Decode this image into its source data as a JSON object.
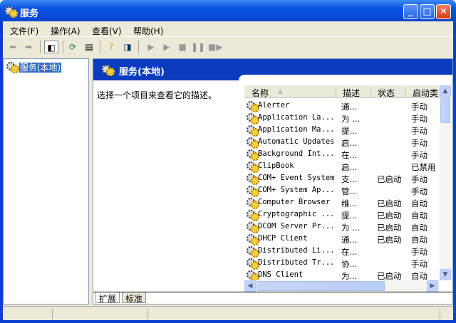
{
  "window": {
    "title": "服务"
  },
  "menu": [
    "文件(F)",
    "操作(A)",
    "查看(V)",
    "帮助(H)"
  ],
  "tree": {
    "node": "服务(本地)"
  },
  "header": {
    "title": "服务(本地)"
  },
  "description": "选择一个项目来查看它的描述。",
  "columns": [
    "名称",
    "描述",
    "状态",
    "启动类"
  ],
  "rows": [
    [
      "Alerter",
      "通...",
      "",
      "手动"
    ],
    [
      "Application La...",
      "为 ...",
      "",
      "手动"
    ],
    [
      "Application Ma...",
      "提...",
      "",
      "手动"
    ],
    [
      "Automatic Updates",
      "启...",
      "",
      "手动"
    ],
    [
      "Background Int...",
      "在...",
      "",
      "手动"
    ],
    [
      "ClipBook",
      "启...",
      "",
      "已禁用"
    ],
    [
      "COM+ Event System",
      "支...",
      "已启动",
      "手动"
    ],
    [
      "COM+ System Ap...",
      "管...",
      "",
      "手动"
    ],
    [
      "Computer Browser",
      "维...",
      "已启动",
      "自动"
    ],
    [
      "Cryptographic ...",
      "提...",
      "已启动",
      "自动"
    ],
    [
      "DCOM Server Pr...",
      "为 ...",
      "已启动",
      "自动"
    ],
    [
      "DHCP Client",
      "通...",
      "已启动",
      "自动"
    ],
    [
      "Distributed Li...",
      "在...",
      "",
      "手动"
    ],
    [
      "Distributed Tr...",
      "协...",
      "",
      "手动"
    ],
    [
      "DNS Client",
      "为...",
      "已启动",
      "自动"
    ]
  ],
  "tabs": [
    "扩展",
    "标准"
  ],
  "icons": [
    "services-gear-icon",
    "back-icon",
    "forward-icon",
    "show-hide-tree-icon",
    "refresh-icon",
    "export-list-icon",
    "help-icon",
    "properties-icon",
    "start-icon",
    "start-alt-icon",
    "stop-icon",
    "pause-icon",
    "restart-icon"
  ]
}
